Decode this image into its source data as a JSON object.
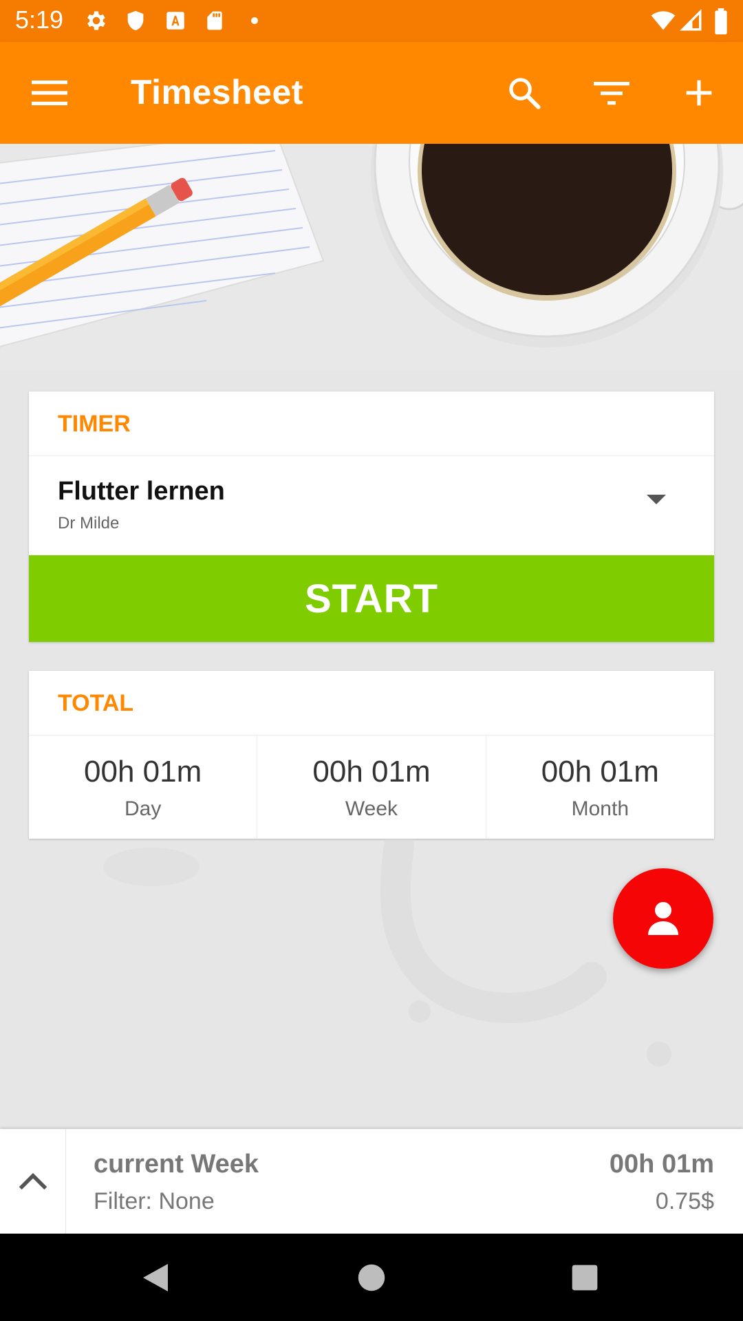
{
  "status_bar": {
    "time": "5:19",
    "left_icons": [
      "gear-icon",
      "shield-icon",
      "font-download-icon",
      "sd-card-icon",
      "dot-icon"
    ],
    "right_icons": [
      "wifi-icon",
      "cell-signal-icon",
      "battery-icon"
    ]
  },
  "app_bar": {
    "title": "Timesheet",
    "icons": [
      "menu-icon",
      "search-icon",
      "filter-icon",
      "plus-icon"
    ]
  },
  "timer_card": {
    "title": "TIMER",
    "project_name": "Flutter lernen",
    "client_name": "Dr Milde",
    "start_label": "START"
  },
  "total_card": {
    "title": "TOTAL",
    "totals": [
      {
        "value": "00h 01m",
        "label": "Day"
      },
      {
        "value": "00h 01m",
        "label": "Week"
      },
      {
        "value": "00h 01m",
        "label": "Month"
      }
    ]
  },
  "fab": {
    "icon": "person-icon"
  },
  "summary": {
    "title": "current Week",
    "filter": "Filter: None",
    "total": "00h 01m",
    "amount": "0.75$"
  },
  "nav_bar": {
    "icons": [
      "back-triangle-icon",
      "home-circle-icon",
      "recents-square-icon"
    ]
  },
  "colors": {
    "status_bar": "#f57c00",
    "app_bar": "#ff8800",
    "accent": "#ff8800",
    "start_button": "#7fcc00",
    "fab": "#f50505"
  }
}
